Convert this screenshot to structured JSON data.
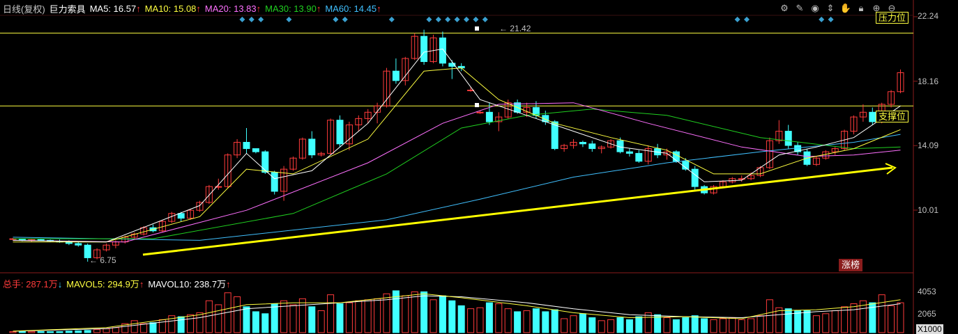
{
  "header": {
    "period": "日线(复权)",
    "stock_name": "巨力索具",
    "ma5": {
      "label": "MA5: 16.57",
      "arrow": "↑",
      "color": "#ffffff"
    },
    "ma10": {
      "label": "MA10: 15.08",
      "arrow": "↑",
      "color": "#ffff40"
    },
    "ma20": {
      "label": "MA20: 13.83",
      "arrow": "↑",
      "color": "#ff70ff"
    },
    "ma30": {
      "label": "MA30: 13.90",
      "arrow": "↑",
      "color": "#20d020"
    },
    "ma60": {
      "label": "MA60: 14.45",
      "arrow": "↑",
      "color": "#40c0ff"
    }
  },
  "volume_header": {
    "total": {
      "label": "总手: 287.1万",
      "arrow": "↓",
      "color": "#ff3b3b"
    },
    "mavol5": {
      "label": "MAVOL5: 294.9万",
      "arrow": "↑",
      "color": "#ffff40"
    },
    "mavol10": {
      "label": "MAVOL10: 238.7万",
      "arrow": "↑",
      "color": "#ffffff"
    }
  },
  "toolbar": [
    "gear-icon",
    "pen-icon",
    "eye-icon",
    "drag-icon",
    "hand-icon",
    "lock-icon",
    "zoom-in-icon",
    "zoom-out-icon"
  ],
  "annotations": {
    "resistance": "压力位",
    "support": "支撑位",
    "high_price": "21.42",
    "low_price": "6.75",
    "zb_badge": "涨榜"
  },
  "chart_data": {
    "type": "candlestick",
    "price_axis": {
      "ticks": [
        "22.24",
        "18.16",
        "14.09",
        "10.01"
      ]
    },
    "volume_axis": {
      "ticks": [
        "4053",
        "2065"
      ],
      "unit": "X1000"
    },
    "resistance_level": 21.2,
    "support_level": 16.6,
    "colors": {
      "up": "#ff3b3b",
      "down": "#40ffff",
      "trendline": "#ffff00",
      "level_line": "#ffff40"
    },
    "candles": [
      [
        8.2,
        8.25,
        8.1,
        8.2
      ],
      [
        8.2,
        8.2,
        8.05,
        8.1
      ],
      [
        8.1,
        8.2,
        8.0,
        8.15
      ],
      [
        8.15,
        8.2,
        8.05,
        8.1
      ],
      [
        8.1,
        8.15,
        8.0,
        8.05
      ],
      [
        8.05,
        8.15,
        7.95,
        8.0
      ],
      [
        8.0,
        8.1,
        7.8,
        7.9
      ],
      [
        7.9,
        8.0,
        7.7,
        7.8
      ],
      [
        7.8,
        7.9,
        6.75,
        7.0
      ],
      [
        7.0,
        7.6,
        6.9,
        7.5
      ],
      [
        7.5,
        7.9,
        7.4,
        7.8
      ],
      [
        7.8,
        8.1,
        7.6,
        8.0
      ],
      [
        8.0,
        8.4,
        7.9,
        8.3
      ],
      [
        8.3,
        8.6,
        8.2,
        8.5
      ],
      [
        8.5,
        9.0,
        8.4,
        8.9
      ],
      [
        8.9,
        9.1,
        8.6,
        8.7
      ],
      [
        8.7,
        9.4,
        8.6,
        9.3
      ],
      [
        9.3,
        9.9,
        9.2,
        9.8
      ],
      [
        9.8,
        9.9,
        9.3,
        9.5
      ],
      [
        9.5,
        10.1,
        9.4,
        10.0
      ],
      [
        10.0,
        10.6,
        9.9,
        10.5
      ],
      [
        10.5,
        11.6,
        10.4,
        11.5
      ],
      [
        11.5,
        12.0,
        11.3,
        11.5
      ],
      [
        11.5,
        13.6,
        11.4,
        13.5
      ],
      [
        13.5,
        14.5,
        13.3,
        14.3
      ],
      [
        14.3,
        15.2,
        13.6,
        13.9
      ],
      [
        13.9,
        13.8,
        13.6,
        13.7
      ],
      [
        13.7,
        13.8,
        12.3,
        12.4
      ],
      [
        12.4,
        12.5,
        11.0,
        11.2
      ],
      [
        11.2,
        12.8,
        10.6,
        12.6
      ],
      [
        12.6,
        13.4,
        12.5,
        13.3
      ],
      [
        13.3,
        14.6,
        13.2,
        14.5
      ],
      [
        14.5,
        15.0,
        13.3,
        13.5
      ],
      [
        13.5,
        13.7,
        13.4,
        13.6
      ],
      [
        13.6,
        15.8,
        13.5,
        15.7
      ],
      [
        15.7,
        16.0,
        14.0,
        14.2
      ],
      [
        14.2,
        15.6,
        13.8,
        15.4
      ],
      [
        15.4,
        16.0,
        15.0,
        15.8
      ],
      [
        15.8,
        16.4,
        15.5,
        16.2
      ],
      [
        16.2,
        16.8,
        15.5,
        16.6
      ],
      [
        16.6,
        19.0,
        16.5,
        18.8
      ],
      [
        18.8,
        19.6,
        18.0,
        18.2
      ],
      [
        18.2,
        19.7,
        17.9,
        19.6
      ],
      [
        19.6,
        21.2,
        19.5,
        21.0
      ],
      [
        21.0,
        21.42,
        19.2,
        19.4
      ],
      [
        19.4,
        21.1,
        19.3,
        20.9
      ],
      [
        20.9,
        21.3,
        19.1,
        19.3
      ],
      [
        19.3,
        19.5,
        18.3,
        19.1
      ],
      [
        19.1,
        19.3,
        18.8,
        19.0
      ],
      [
        17.6,
        17.8,
        17.5,
        17.6
      ],
      [
        16.2,
        16.3,
        16.1,
        16.2
      ],
      [
        16.2,
        16.8,
        15.4,
        15.6
      ],
      [
        15.6,
        16.2,
        15.0,
        15.9
      ],
      [
        15.9,
        17.0,
        15.8,
        16.8
      ],
      [
        16.8,
        17.0,
        16.1,
        16.2
      ],
      [
        16.2,
        16.8,
        15.9,
        16.5
      ],
      [
        16.5,
        16.9,
        15.8,
        16.0
      ],
      [
        16.0,
        16.3,
        15.4,
        15.6
      ],
      [
        15.6,
        15.7,
        13.8,
        13.9
      ],
      [
        13.9,
        14.2,
        13.7,
        14.1
      ],
      [
        14.1,
        14.5,
        13.9,
        14.3
      ],
      [
        14.3,
        14.4,
        14.0,
        14.2
      ],
      [
        14.2,
        14.4,
        13.7,
        13.9
      ],
      [
        13.9,
        14.1,
        13.6,
        14.0
      ],
      [
        14.0,
        14.5,
        13.9,
        14.4
      ],
      [
        14.4,
        14.6,
        13.6,
        13.7
      ],
      [
        13.7,
        13.9,
        13.4,
        13.6
      ],
      [
        13.6,
        13.8,
        13.0,
        13.1
      ],
      [
        13.1,
        14.1,
        12.9,
        13.9
      ],
      [
        13.9,
        14.2,
        13.3,
        13.5
      ],
      [
        13.5,
        13.9,
        13.2,
        13.7
      ],
      [
        13.7,
        13.8,
        13.0,
        13.1
      ],
      [
        13.1,
        13.3,
        12.5,
        12.6
      ],
      [
        12.6,
        12.8,
        11.3,
        11.5
      ],
      [
        11.5,
        11.6,
        11.0,
        11.1
      ],
      [
        11.1,
        11.6,
        11.0,
        11.5
      ],
      [
        11.5,
        11.9,
        11.4,
        11.8
      ],
      [
        11.8,
        12.1,
        11.7,
        12.0
      ],
      [
        12.0,
        12.2,
        11.8,
        12.0
      ],
      [
        12.0,
        12.4,
        11.9,
        12.2
      ],
      [
        12.2,
        12.8,
        12.1,
        12.7
      ],
      [
        12.7,
        14.6,
        12.6,
        14.4
      ],
      [
        14.4,
        15.7,
        14.2,
        15.0
      ],
      [
        15.0,
        15.4,
        13.9,
        14.1
      ],
      [
        14.1,
        14.3,
        13.5,
        13.7
      ],
      [
        13.7,
        13.9,
        12.8,
        12.9
      ],
      [
        12.9,
        13.4,
        12.8,
        13.3
      ],
      [
        13.3,
        13.8,
        13.2,
        13.7
      ],
      [
        13.7,
        14.0,
        13.5,
        13.9
      ],
      [
        13.9,
        15.1,
        13.8,
        15.0
      ],
      [
        15.0,
        16.0,
        14.8,
        15.9
      ],
      [
        15.9,
        16.7,
        15.6,
        16.2
      ],
      [
        16.2,
        16.5,
        15.4,
        15.6
      ],
      [
        15.6,
        16.8,
        15.5,
        16.7
      ],
      [
        16.7,
        17.6,
        16.5,
        17.5
      ],
      [
        17.5,
        18.9,
        17.4,
        18.7
      ]
    ],
    "volume": [
      100,
      130,
      120,
      110,
      100,
      100,
      150,
      180,
      220,
      300,
      380,
      500,
      900,
      1200,
      900,
      1000,
      1300,
      1700,
      1600,
      1800,
      2000,
      3200,
      2800,
      4000,
      3600,
      2600,
      2100,
      1900,
      2900,
      3200,
      2800,
      3400,
      2600,
      2200,
      3800,
      2900,
      3000,
      3200,
      3300,
      3400,
      3900,
      4200,
      3700,
      4100,
      4100,
      3300,
      3700,
      3200,
      2700,
      2400,
      2500,
      3000,
      2900,
      2400,
      2100,
      2200,
      2400,
      2100,
      2300,
      1400,
      1700,
      1900,
      1500,
      1200,
      1300,
      1500,
      1300,
      1600,
      2000,
      1800,
      1500,
      1300,
      1500,
      1700,
      1400,
      1300,
      1400,
      1500,
      1300,
      1400,
      1700,
      3300,
      2500,
      2400,
      2200,
      2200,
      1700,
      1900,
      2200,
      2600,
      2900,
      3200,
      3000,
      3800,
      2700,
      3000
    ],
    "ma60_path": [
      [
        0,
        8.3
      ],
      [
        20,
        8.1
      ],
      [
        40,
        9.4
      ],
      [
        50,
        10.7
      ],
      [
        60,
        12.1
      ],
      [
        70,
        13.0
      ],
      [
        80,
        13.7
      ],
      [
        90,
        14.3
      ],
      [
        95,
        14.8
      ]
    ],
    "ma30_path": [
      [
        0,
        8.2
      ],
      [
        15,
        8.2
      ],
      [
        30,
        9.8
      ],
      [
        40,
        12.3
      ],
      [
        48,
        15.2
      ],
      [
        55,
        16.0
      ],
      [
        62,
        16.4
      ],
      [
        70,
        16.0
      ],
      [
        80,
        14.6
      ],
      [
        90,
        13.9
      ],
      [
        95,
        14.0
      ]
    ],
    "ma20_path": [
      [
        0,
        8.1
      ],
      [
        12,
        8.0
      ],
      [
        25,
        10.0
      ],
      [
        38,
        13.0
      ],
      [
        46,
        15.5
      ],
      [
        52,
        16.7
      ],
      [
        60,
        16.8
      ],
      [
        68,
        15.5
      ],
      [
        78,
        14.0
      ],
      [
        85,
        13.4
      ],
      [
        90,
        13.5
      ],
      [
        95,
        13.8
      ]
    ],
    "ma10_path": [
      [
        0,
        8.0
      ],
      [
        10,
        8.0
      ],
      [
        20,
        9.6
      ],
      [
        25,
        12.6
      ],
      [
        30,
        12.3
      ],
      [
        38,
        14.5
      ],
      [
        44,
        18.8
      ],
      [
        48,
        19.0
      ],
      [
        52,
        17.0
      ],
      [
        58,
        15.5
      ],
      [
        64,
        14.6
      ],
      [
        70,
        13.8
      ],
      [
        75,
        12.3
      ],
      [
        80,
        12.3
      ],
      [
        85,
        13.3
      ],
      [
        90,
        13.9
      ],
      [
        95,
        15.1
      ]
    ],
    "ma5_path": [
      [
        0,
        8.1
      ],
      [
        10,
        8.0
      ],
      [
        20,
        10.3
      ],
      [
        25,
        13.6
      ],
      [
        28,
        12.0
      ],
      [
        32,
        12.5
      ],
      [
        38,
        15.5
      ],
      [
        44,
        20.0
      ],
      [
        46,
        20.2
      ],
      [
        50,
        17.0
      ],
      [
        55,
        16.0
      ],
      [
        60,
        15.0
      ],
      [
        65,
        14.0
      ],
      [
        70,
        13.6
      ],
      [
        74,
        11.8
      ],
      [
        78,
        11.9
      ],
      [
        82,
        13.5
      ],
      [
        86,
        14.0
      ],
      [
        90,
        14.6
      ],
      [
        95,
        16.6
      ]
    ],
    "mavol5_path": [
      [
        0,
        150
      ],
      [
        10,
        500
      ],
      [
        20,
        1800
      ],
      [
        25,
        2800
      ],
      [
        30,
        3000
      ],
      [
        35,
        3000
      ],
      [
        40,
        3500
      ],
      [
        44,
        3900
      ],
      [
        48,
        3500
      ],
      [
        55,
        2700
      ],
      [
        60,
        2000
      ],
      [
        66,
        1500
      ],
      [
        72,
        1600
      ],
      [
        78,
        1400
      ],
      [
        82,
        2200
      ],
      [
        86,
        2300
      ],
      [
        90,
        2600
      ],
      [
        95,
        3300
      ]
    ],
    "mavol10_path": [
      [
        0,
        140
      ],
      [
        10,
        400
      ],
      [
        20,
        1500
      ],
      [
        25,
        2400
      ],
      [
        30,
        2700
      ],
      [
        35,
        3000
      ],
      [
        40,
        3300
      ],
      [
        44,
        3700
      ],
      [
        48,
        3600
      ],
      [
        55,
        3000
      ],
      [
        60,
        2400
      ],
      [
        66,
        1800
      ],
      [
        72,
        1600
      ],
      [
        78,
        1500
      ],
      [
        82,
        1800
      ],
      [
        86,
        2100
      ],
      [
        90,
        2300
      ],
      [
        95,
        2900
      ]
    ]
  }
}
